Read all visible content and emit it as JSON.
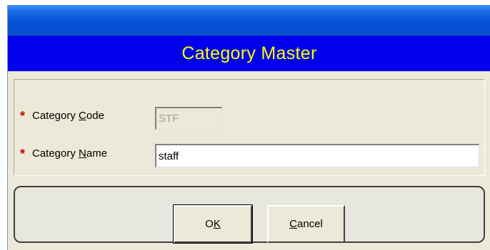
{
  "dialog": {
    "title": "Category Master"
  },
  "form": {
    "required_marker": "*",
    "category_code": {
      "label_before": "Category ",
      "label_mnemonic": "C",
      "label_after": "ode",
      "value": "STF"
    },
    "category_name": {
      "label_before": "Category ",
      "label_mnemonic": "N",
      "label_after": "ame",
      "value": "staff"
    }
  },
  "buttons": {
    "ok": {
      "mnemonic": "O",
      "rest": "K"
    },
    "cancel": {
      "mnemonic": "C",
      "rest": "ancel"
    }
  },
  "colors": {
    "header_background": "#0000ee",
    "header_text": "#ffff00",
    "required_marker": "#cc0000",
    "window_background": "#ece9d8"
  }
}
